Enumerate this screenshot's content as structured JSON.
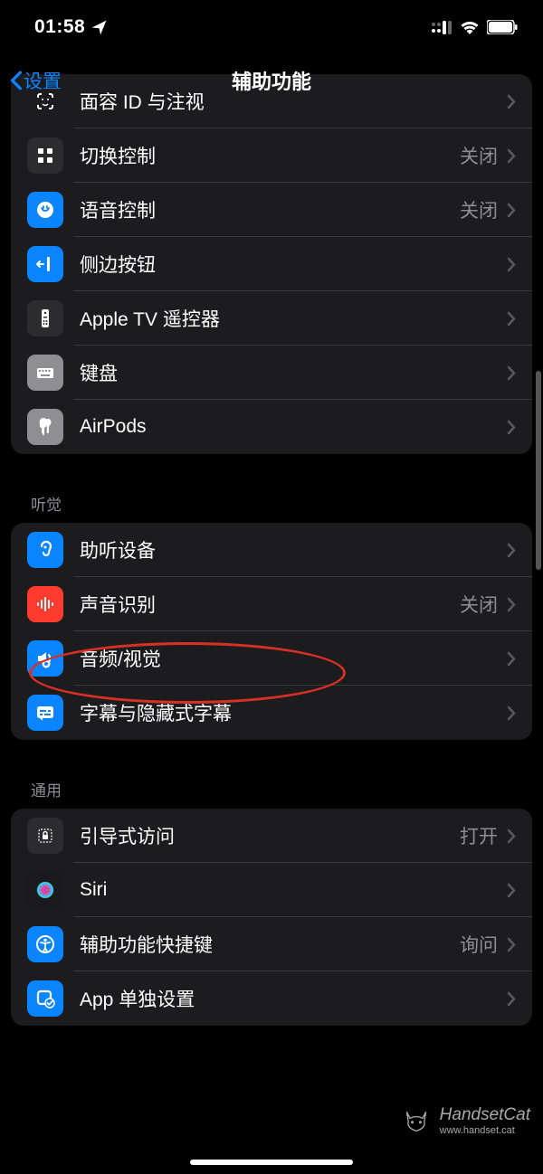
{
  "status": {
    "time": "01:58"
  },
  "nav": {
    "back": "设置",
    "title": "辅助功能"
  },
  "group1": {
    "items": [
      {
        "label": "面容 ID 与注视",
        "value": "",
        "color": "#34c759",
        "icon": "face"
      },
      {
        "label": "切换控制",
        "value": "关闭",
        "color": "#2c2c2e",
        "icon": "switch"
      },
      {
        "label": "语音控制",
        "value": "关闭",
        "color": "#0a84ff",
        "icon": "voice"
      },
      {
        "label": "侧边按钮",
        "value": "",
        "color": "#0a84ff",
        "icon": "side"
      },
      {
        "label": "Apple TV 遥控器",
        "value": "",
        "color": "#2c2c2e",
        "icon": "remote"
      },
      {
        "label": "键盘",
        "value": "",
        "color": "#8e8e93",
        "icon": "keyboard"
      },
      {
        "label": "AirPods",
        "value": "",
        "color": "#8e8e93",
        "icon": "airpods"
      }
    ]
  },
  "group2": {
    "header": "听觉",
    "items": [
      {
        "label": "助听设备",
        "value": "",
        "color": "#0a84ff",
        "icon": "ear"
      },
      {
        "label": "声音识别",
        "value": "关闭",
        "color": "#ff3b30",
        "icon": "sound"
      },
      {
        "label": "音频/视觉",
        "value": "",
        "color": "#0a84ff",
        "icon": "av"
      },
      {
        "label": "字幕与隐藏式字幕",
        "value": "",
        "color": "#0a84ff",
        "icon": "cc"
      }
    ]
  },
  "group3": {
    "header": "通用",
    "items": [
      {
        "label": "引导式访问",
        "value": "打开",
        "color": "#2c2c2e",
        "icon": "guided"
      },
      {
        "label": "Siri",
        "value": "",
        "color": "#000",
        "icon": "siri"
      },
      {
        "label": "辅助功能快捷键",
        "value": "询问",
        "color": "#0a84ff",
        "icon": "access"
      },
      {
        "label": "App 单独设置",
        "value": "",
        "color": "#0a84ff",
        "icon": "perapp"
      }
    ]
  },
  "watermark": "HandsetCat",
  "watermark_url": "www.handset.cat"
}
